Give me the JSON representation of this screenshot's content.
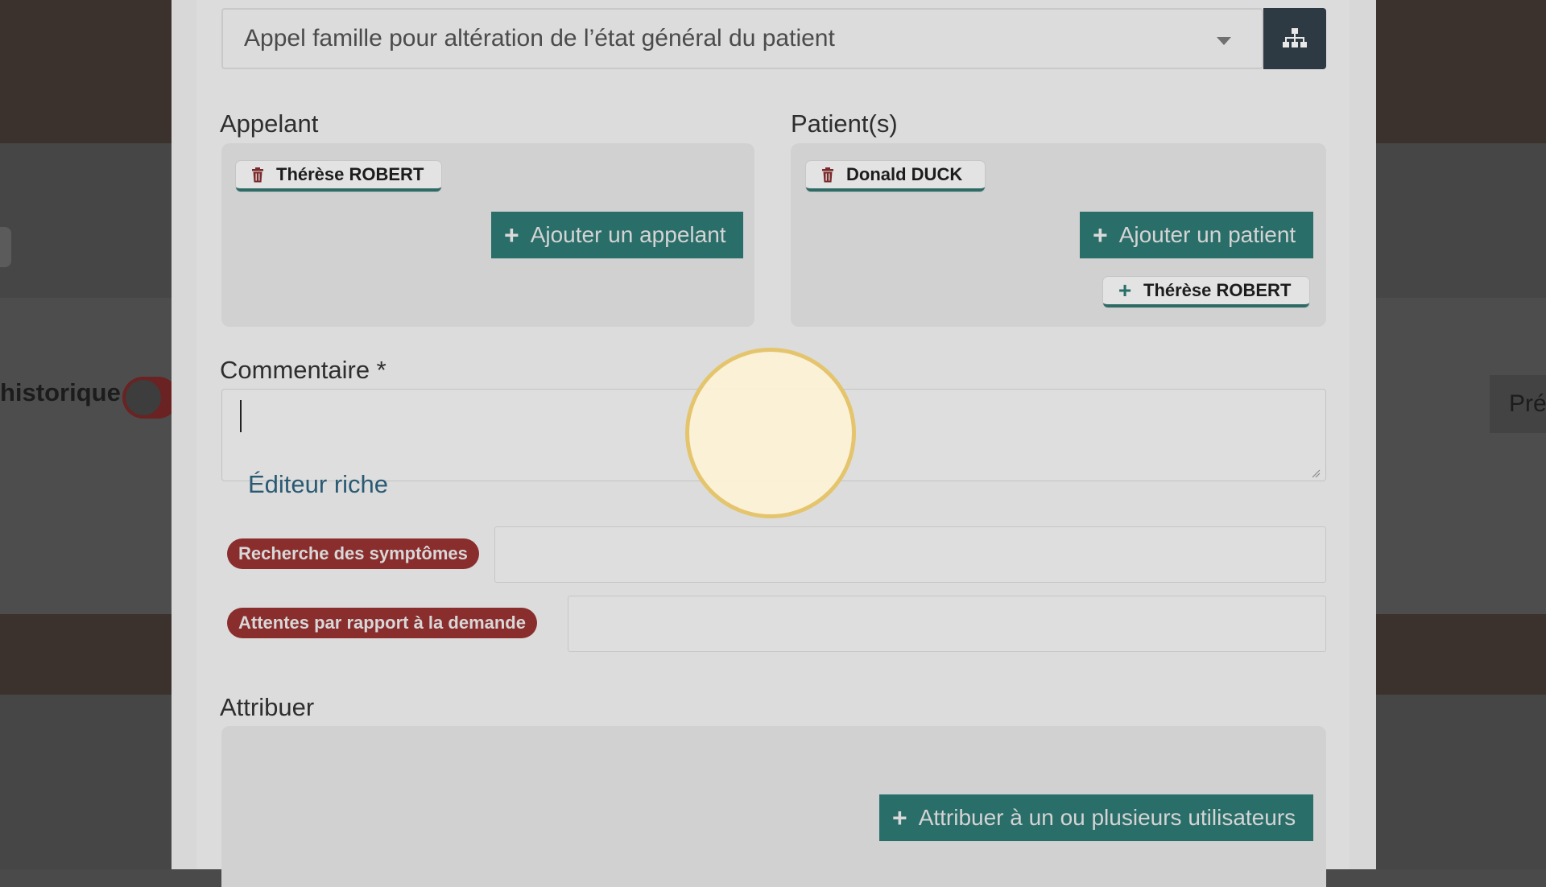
{
  "background": {
    "historique_label": "historique",
    "pre_label": "Pré"
  },
  "form": {
    "call_reason": {
      "selected_value": "Appel famille pour altération de l’état général du patient",
      "tree_icon": "sitemap-icon"
    },
    "caller": {
      "label": "Appelant",
      "chips": [
        {
          "name": "Thérèse ROBERT",
          "icon": "trash-icon"
        }
      ],
      "add_button": "Ajouter un appelant"
    },
    "patients": {
      "label": "Patient(s)",
      "chips": [
        {
          "name": "Donald DUCK",
          "icon": "trash-icon"
        }
      ],
      "add_button": "Ajouter un patient",
      "suggestions": [
        {
          "name": "Thérèse ROBERT",
          "icon": "plus-icon"
        }
      ]
    },
    "comment": {
      "label": "Commentaire *",
      "value": "",
      "rich_editor_link": "Éditeur riche"
    },
    "fields": [
      {
        "tag": "Recherche des symptômes",
        "value": ""
      },
      {
        "tag": "Attentes par rapport à la demande",
        "value": ""
      }
    ],
    "assign": {
      "label": "Attribuer",
      "button": "Attribuer à un ou plusieurs utilisateurs"
    }
  },
  "colors": {
    "teal": "#2a6e69",
    "tag_red": "#8a2d2d",
    "dark_button": "#2d3a44",
    "click_highlight": "#e4c56d"
  }
}
